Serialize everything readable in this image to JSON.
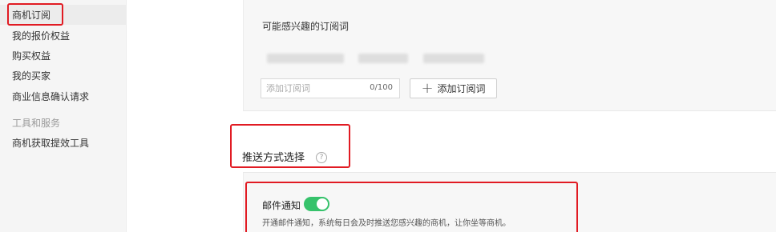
{
  "sidebar": {
    "items": [
      {
        "label": "商机订阅"
      },
      {
        "label": "我的报价权益"
      },
      {
        "label": "购买权益"
      },
      {
        "label": "我的买家"
      },
      {
        "label": "商业信息确认请求"
      }
    ],
    "group_title": "工具和服务",
    "tools": [
      {
        "label": "商机获取提效工具"
      }
    ]
  },
  "subscription": {
    "title": "可能感兴趣的订阅词",
    "input_placeholder": "添加订阅词",
    "counter": "0/100",
    "add_button_label": "添加订阅词"
  },
  "push": {
    "title": "推送方式选择",
    "help_symbol": "?",
    "email_label": "邮件通知",
    "email_enabled": true,
    "email_desc": "开通邮件通知，系统每日会及时推送您感兴趣的商机，让你坐等商机。"
  },
  "colors": {
    "highlight": "#e11b23",
    "toggle_on": "#36c26b"
  }
}
